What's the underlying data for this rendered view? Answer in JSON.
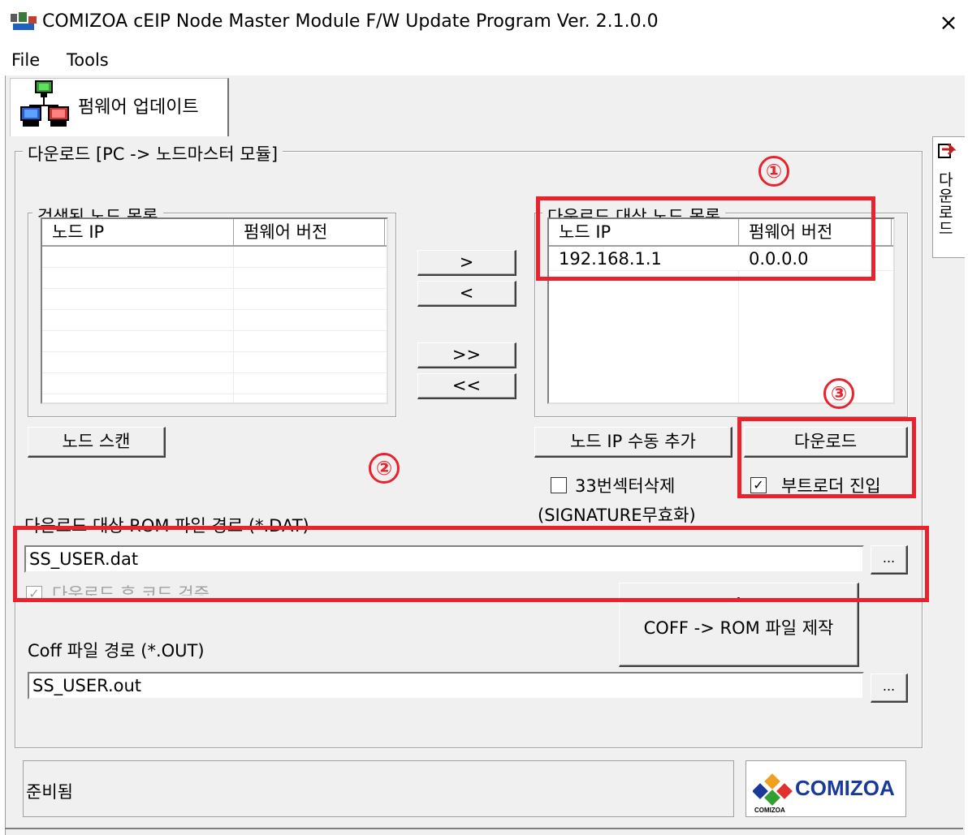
{
  "window": {
    "title": "COMIZOA cEIP Node Master Module F/W Update Program Ver. 2.1.0.0",
    "close_glyph": "×"
  },
  "menu": {
    "items": [
      "File",
      "Tools"
    ]
  },
  "tabs": {
    "firmware_update": "펌웨어 업데이트",
    "side_tab": "다운로드"
  },
  "download_group": {
    "label": "다운로드 [PC -> 노드마스터 모듈]",
    "searched_nodes": {
      "label": "검색된 노드 목록",
      "columns": [
        "노드 IP",
        "펌웨어 버전"
      ],
      "rows": []
    },
    "target_nodes": {
      "label": "다운로드 대상 노드 목록",
      "columns": [
        "노드 IP",
        "펌웨어 버전"
      ],
      "rows": [
        {
          "ip": "192.168.1.1",
          "version": "0.0.0.0"
        }
      ]
    },
    "buttons": {
      "move_right": ">",
      "move_left": "<",
      "move_all_right": ">>",
      "move_all_left": "<<",
      "node_scan": "노드 스캔",
      "add_ip_manually": "노드 IP  수동 추가",
      "download": "다운로드"
    },
    "checkboxes": {
      "delete_sector33": {
        "label": "33번섹터삭제",
        "checked": false
      },
      "signature_note": "(SIGNATURE무효화)",
      "bootloader_enter": {
        "label": "부트로더 진입",
        "checked": true
      },
      "verify_after_download": {
        "label": "다운로드 후 코드 검증",
        "checked": true
      }
    },
    "rom_path": {
      "label": "다운로드 대상 ROM 파일 경로 (*.DAT)",
      "value": "SS_USER.dat",
      "browse": "..."
    },
    "coff_path": {
      "label": "Coff 파일 경로 (*.OUT)",
      "value": "SS_USER.out",
      "browse": "..."
    },
    "coff_to_rom": {
      "caret": "^",
      "label": "COFF -> ROM 파일 제작"
    }
  },
  "annotations": {
    "marker1": "①",
    "marker2": "②",
    "marker3": "③",
    "color": "#e8232d"
  },
  "status": {
    "text": "준비됨"
  },
  "logo": {
    "text": "COMIZOA",
    "subtext": "COMIZOA",
    "color": "#1a3a9a"
  }
}
